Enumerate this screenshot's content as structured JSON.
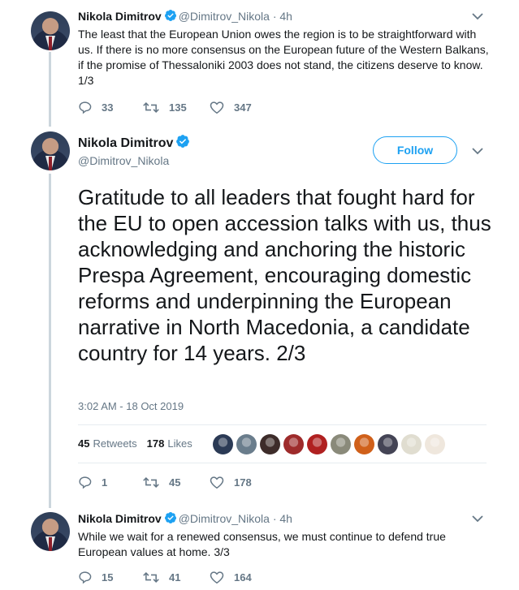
{
  "tweets": [
    {
      "name": "Nikola Dimitrov",
      "handle": "@Dimitrov_Nikola",
      "time": "4h",
      "text": "The least that the European Union owes the region is to be straightforward with us. If there is no more consensus on the European future of the Western Balkans, if the promise of Thessaloniki 2003 does not stand, the citizens deserve to know. 1/3",
      "replies": "33",
      "retweets": "135",
      "likes": "347"
    },
    {
      "name": "Nikola Dimitrov",
      "handle": "@Dimitrov_Nikola",
      "follow_label": "Follow",
      "text": "Gratitude to all leaders that fought hard for the EU to open accession talks with us, thus acknowledging and anchoring the historic Prespa Agreement, encouraging domestic reforms and underpinning the European narrative in North Macedonia, a candidate country for 14 years. 2/3",
      "timestamp": "3:02 AM - 18 Oct 2019",
      "retweet_count": "45",
      "retweet_label": "Retweets",
      "like_count": "178",
      "like_label": "Likes",
      "replies": "1",
      "retweets": "45",
      "likes": "178"
    },
    {
      "name": "Nikola Dimitrov",
      "handle": "@Dimitrov_Nikola",
      "time": "4h",
      "text": "While we wait for a renewed consensus, we must continue to defend true European values at home. 3/3",
      "replies": "15",
      "retweets": "41",
      "likes": "164"
    }
  ],
  "separator": "·",
  "colors": {
    "accent": "#1da1f2",
    "muted": "#657786",
    "text": "#14171a",
    "thread_line": "#ccd6dd"
  },
  "icons": [
    "verified-badge-icon",
    "chevron-down-icon",
    "reply-icon",
    "retweet-icon",
    "like-icon"
  ],
  "liker_colors": [
    "#2b3a55",
    "#6a7d8c",
    "#3d2c2a",
    "#9e2b2b",
    "#b02020",
    "#8a8a7a",
    "#d0601a",
    "#444455",
    "#e0ddd0",
    "#efe7dd"
  ]
}
